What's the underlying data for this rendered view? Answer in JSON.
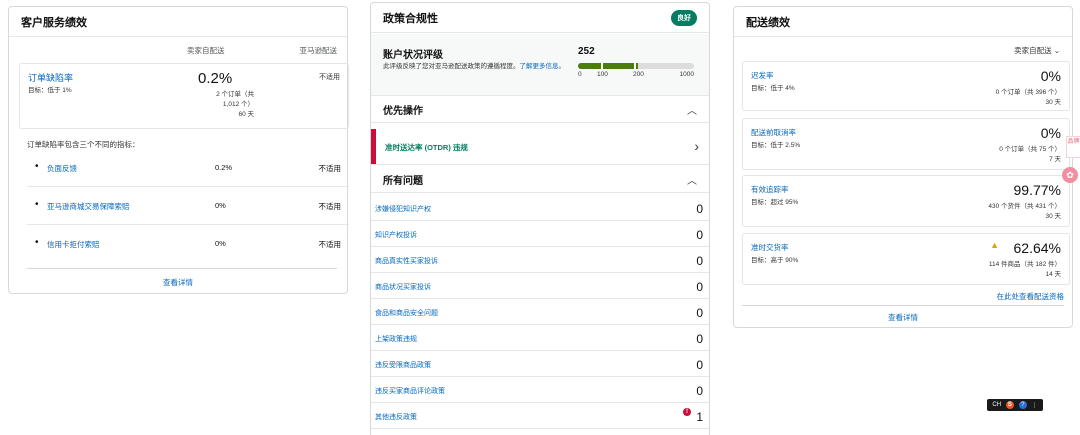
{
  "customer_service": {
    "title": "客户服务绩效",
    "col_seller": "卖家自配送",
    "col_amazon": "亚马逊配送",
    "odr": {
      "name": "订单缺陷率",
      "target": "目标：低于 1%",
      "percent": "0.2%",
      "amazon": "不适用",
      "detail_1": "2 个订单（共",
      "detail_2": "1,012 个）",
      "detail_3": "60 天"
    },
    "note": "订单缺陷率包含三个不同的指标：",
    "metrics": [
      {
        "bullet": "•",
        "name": "负面反馈",
        "value": "0.2%",
        "amazon": "不适用"
      },
      {
        "bullet": "•",
        "name": "亚马逊商城交易保障索赔",
        "value": "0%",
        "amazon": "不适用"
      },
      {
        "bullet": "•",
        "name": "信用卡拒付索赔",
        "value": "0%",
        "amazon": "不适用"
      }
    ],
    "footer_link": "查看详情"
  },
  "policy": {
    "title": "政策合规性",
    "badge": "良好",
    "ahr": {
      "title": "账户状况评级",
      "desc_text": "此评级反映了您对亚马逊配送政策的遵循程度。",
      "desc_link": "了解更多信息。",
      "score": "252",
      "score_value": 252,
      "score_max": 1000,
      "tick_0": "0",
      "tick_100": "100",
      "tick_200": "200",
      "tick_1000": "1000"
    },
    "priority_title": "优先操作",
    "priority_item": "准时送达率 (OTDR) 违规",
    "issues_title": "所有问题",
    "issues": [
      {
        "name": "涉嫌侵犯知识产权",
        "count": "0"
      },
      {
        "name": "知识产权投诉",
        "count": "0"
      },
      {
        "name": "商品真实性买家投诉",
        "count": "0"
      },
      {
        "name": "商品状况买家投诉",
        "count": "0"
      },
      {
        "name": "食品和商品安全问题",
        "count": "0"
      },
      {
        "name": "上架政策违规",
        "count": "0"
      },
      {
        "name": "违反受限商品政策",
        "count": "0"
      },
      {
        "name": "违反买家商品评论政策",
        "count": "0"
      },
      {
        "name": "其他违反政策",
        "count": "1",
        "alert": "!"
      }
    ]
  },
  "shipping": {
    "title": "配送绩效",
    "filter": "卖家自配送",
    "metrics": [
      {
        "name": "迟发率",
        "target": "目标：低于 4%",
        "value": "0%",
        "detail_1": "0 个订单（共 396 个）",
        "detail_2": "30 天"
      },
      {
        "name": "配送前取消率",
        "target": "目标：低于 2.5%",
        "value": "0%",
        "detail_1": "0 个订单（共 75 个）",
        "detail_2": "7 天"
      },
      {
        "name": "有效追踪率",
        "target": "目标：超过 95%",
        "value": "99.77%",
        "detail_1": "430 个货件（共 431 个）",
        "detail_2": "30 天"
      },
      {
        "name": "准时交货率",
        "target": "目标：高于 90%",
        "value": "62.64%",
        "detail_1": "114 件商品（共 182 件）",
        "detail_2": "14 天",
        "warning": "▲"
      }
    ],
    "eligibility_link": "在此处查看配送资格",
    "footer_link": "查看详情"
  },
  "floaters": {
    "side_tab": "品牌",
    "side_circle": "✿",
    "ime_label": "CH",
    "ime_s": "S",
    "ime_help": "?",
    "ime_menu": "⋮"
  }
}
